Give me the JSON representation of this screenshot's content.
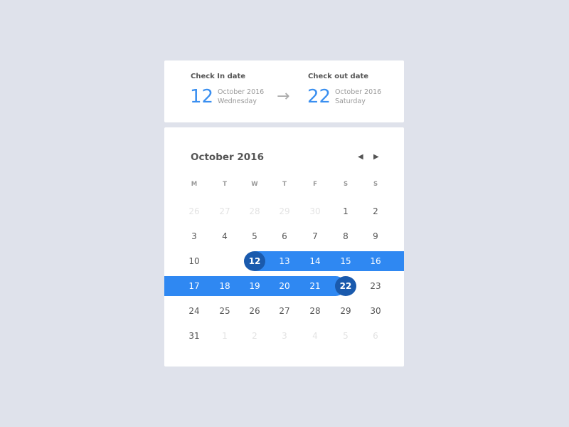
{
  "checkin": {
    "label": "Check In date",
    "day": "12",
    "month": "October 2016",
    "weekday": "Wednesday"
  },
  "checkout": {
    "label": "Check out date",
    "day": "22",
    "month": "October 2016",
    "weekday": "Saturday"
  },
  "arrow_icon": "arrow-right-icon",
  "calendar": {
    "month_label": "October 2016",
    "prev_icon": "caret-left-icon",
    "next_icon": "caret-right-icon",
    "prev_glyph": "◀",
    "next_glyph": "▶",
    "arrow_glyph": "→",
    "weekdays": [
      "M",
      "T",
      "W",
      "T",
      "F",
      "S",
      "S"
    ],
    "weeks": [
      [
        {
          "d": "26",
          "m": 1
        },
        {
          "d": "27",
          "m": 1
        },
        {
          "d": "28",
          "m": 1
        },
        {
          "d": "29",
          "m": 1
        },
        {
          "d": "30",
          "m": 1
        },
        {
          "d": "1"
        },
        {
          "d": "2"
        }
      ],
      [
        {
          "d": "3"
        },
        {
          "d": "4"
        },
        {
          "d": "5"
        },
        {
          "d": "6"
        },
        {
          "d": "7"
        },
        {
          "d": "8"
        },
        {
          "d": "9"
        }
      ],
      [
        {
          "d": "10"
        },
        {
          "d": ""
        },
        {
          "d": "12",
          "s": 1
        },
        {
          "d": "13",
          "r": 1
        },
        {
          "d": "14",
          "r": 1
        },
        {
          "d": "15",
          "r": 1
        },
        {
          "d": "16",
          "r": 1
        }
      ],
      [
        {
          "d": "17",
          "r": 1
        },
        {
          "d": "18",
          "r": 1
        },
        {
          "d": "19",
          "r": 1
        },
        {
          "d": "20",
          "r": 1
        },
        {
          "d": "21",
          "r": 1
        },
        {
          "d": "22",
          "s": 1
        },
        {
          "d": "23"
        }
      ],
      [
        {
          "d": "24"
        },
        {
          "d": "25"
        },
        {
          "d": "26"
        },
        {
          "d": "27"
        },
        {
          "d": "28"
        },
        {
          "d": "29"
        },
        {
          "d": "30"
        }
      ],
      [
        {
          "d": "31"
        },
        {
          "d": "1",
          "m": 1
        },
        {
          "d": "2",
          "m": 1
        },
        {
          "d": "3",
          "m": 1
        },
        {
          "d": "4",
          "m": 1
        },
        {
          "d": "5",
          "m": 1
        },
        {
          "d": "6",
          "m": 1
        }
      ]
    ],
    "colors": {
      "range": "#2f88f2",
      "selected": "#1a5aad",
      "accent": "#3a8ff0"
    }
  }
}
